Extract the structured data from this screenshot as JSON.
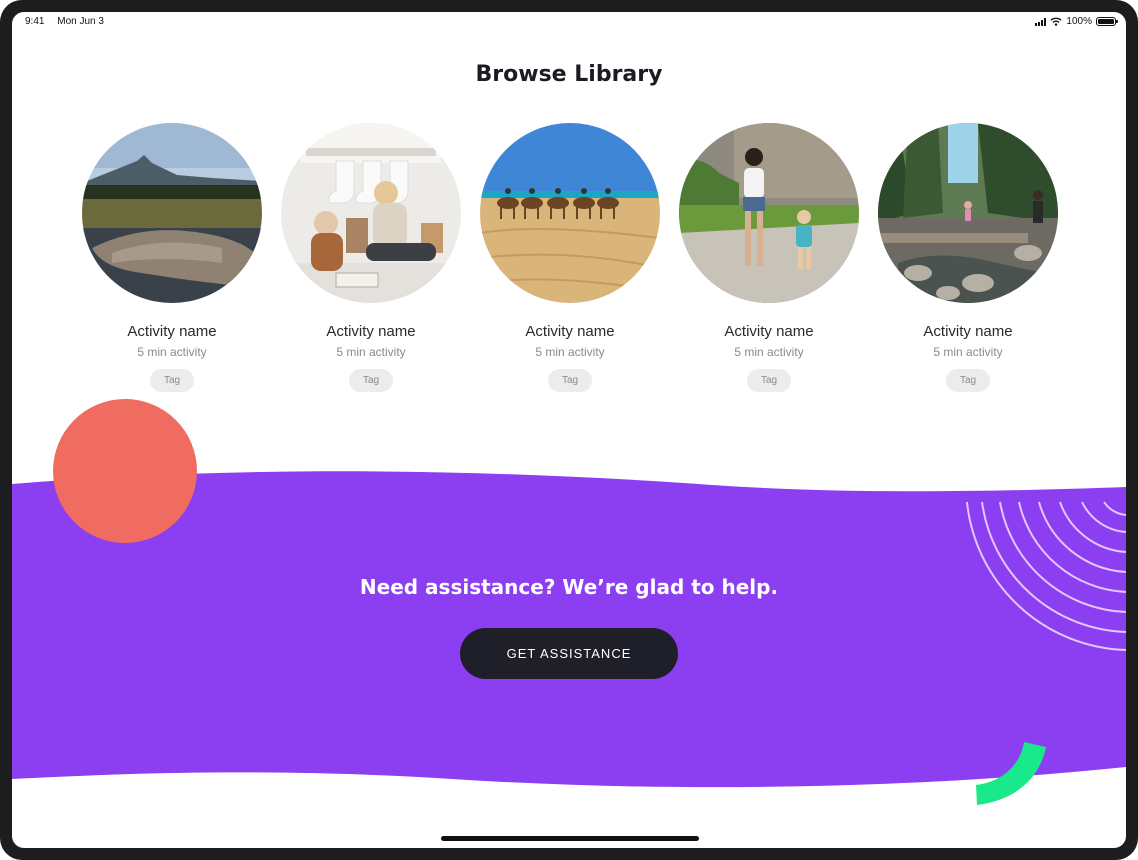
{
  "status_bar": {
    "time": "9:41",
    "date": "Mon Jun 3",
    "battery": "100%"
  },
  "title": "Browse Library",
  "activities": [
    {
      "name": "Activity name",
      "duration": "5 min activity",
      "tag": "Tag",
      "image": "lake-mountain-photo"
    },
    {
      "name": "Activity name",
      "duration": "5 min activity",
      "tag": "Tag",
      "image": "mother-child-christmas-photo"
    },
    {
      "name": "Activity name",
      "duration": "5 min activity",
      "tag": "Tag",
      "image": "camels-beach-photo"
    },
    {
      "name": "Activity name",
      "duration": "5 min activity",
      "tag": "Tag",
      "image": "mother-son-walk-photo"
    },
    {
      "name": "Activity name",
      "duration": "5 min activity",
      "tag": "Tag",
      "image": "forest-creek-photo"
    }
  ],
  "help_banner": {
    "heading": "Need assistance? We’re glad to help.",
    "button_label": "GET ASSISTANCE"
  },
  "colors": {
    "banner": "#8b3ff0",
    "coral_circle": "#f06b60",
    "green_arc": "#19e98a",
    "button": "#1f1f2a"
  }
}
